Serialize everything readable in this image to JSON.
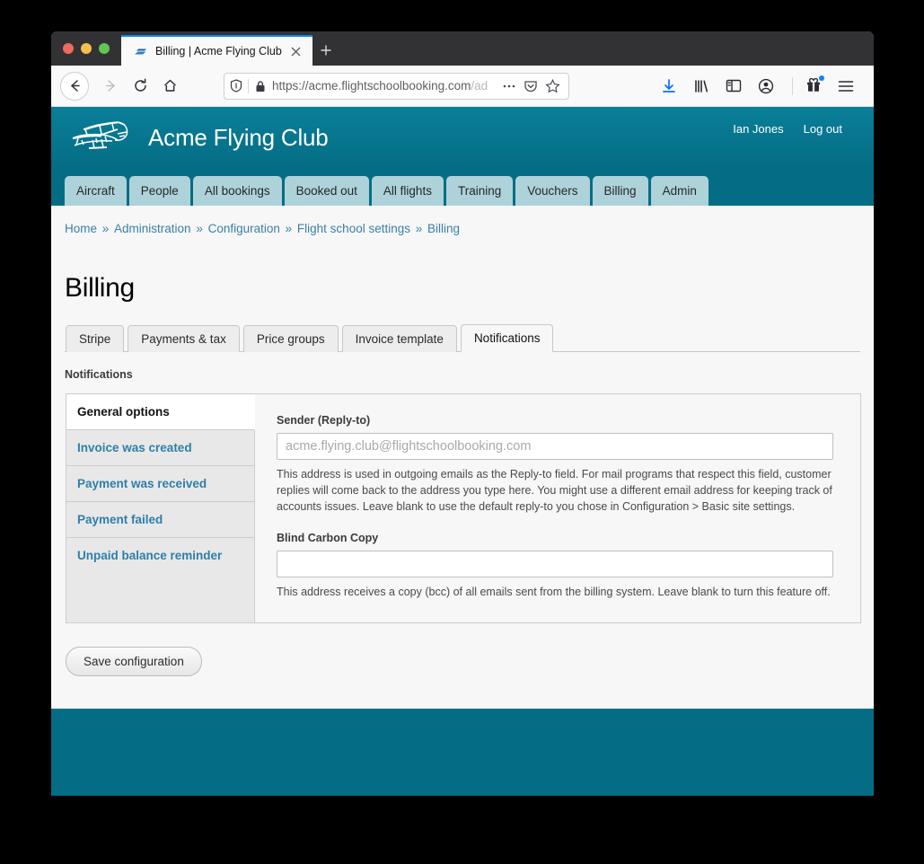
{
  "browser": {
    "tab": {
      "title": "Billing | Acme Flying Club",
      "favicon_icon": "plane-swoosh-favicon",
      "close_icon": "close-icon"
    },
    "new_tab_label": "+",
    "new_tab_icon": "plus-icon",
    "nav": {
      "back_icon": "arrow-left-icon",
      "forward_icon": "arrow-right-icon",
      "reload_icon": "reload-icon",
      "home_icon": "home-icon"
    },
    "urlbar": {
      "shield_icon": "shield-icon",
      "lock_icon": "lock-icon",
      "url_visible": "https://acme.flightschoolbooking.com",
      "url_faded": "/ad",
      "page_actions_icon": "ellipsis-icon",
      "pocket_icon": "pocket-icon",
      "bookmark_icon": "star-icon"
    },
    "toolbar": {
      "downloads_icon": "download-icon",
      "library_icon": "library-icon",
      "sidebar_icon": "sidebar-icon",
      "account_icon": "account-icon",
      "gift_icon": "gift-icon",
      "menu_icon": "hamburger-menu-icon",
      "downloads_accent": "#0a6cff",
      "gift_badge_accent": "#0a84ff"
    }
  },
  "site": {
    "title": "Acme Flying Club",
    "logo_icon": "biplane-logo-icon",
    "header_accent": "#046d85",
    "user": {
      "name": "Ian Jones",
      "logout_label": "Log out"
    },
    "nav_tabs": [
      {
        "label": "Aircraft"
      },
      {
        "label": "People"
      },
      {
        "label": "All bookings"
      },
      {
        "label": "Booked out"
      },
      {
        "label": "All flights"
      },
      {
        "label": "Training"
      },
      {
        "label": "Vouchers"
      },
      {
        "label": "Billing"
      },
      {
        "label": "Admin"
      }
    ],
    "nav_tab_color": "#aed2d9"
  },
  "breadcrumb": {
    "separator": "»",
    "items": [
      {
        "label": "Home"
      },
      {
        "label": "Administration"
      },
      {
        "label": "Configuration"
      },
      {
        "label": "Flight school settings"
      },
      {
        "label": "Billing"
      }
    ],
    "link_color": "#3a80a8"
  },
  "page": {
    "title": "Billing",
    "subtabs": [
      {
        "label": "Stripe",
        "active": false
      },
      {
        "label": "Payments & tax",
        "active": false
      },
      {
        "label": "Price groups",
        "active": false
      },
      {
        "label": "Invoice template",
        "active": false
      },
      {
        "label": "Notifications",
        "active": true
      }
    ],
    "section_label": "Notifications"
  },
  "vertical_tabs": {
    "items": [
      {
        "label": "General options",
        "active": true
      },
      {
        "label": "Invoice was created",
        "active": false
      },
      {
        "label": "Payment was received",
        "active": false
      },
      {
        "label": "Payment failed",
        "active": false
      },
      {
        "label": "Unpaid balance reminder",
        "active": false
      }
    ],
    "link_color": "#2e7fa8"
  },
  "form": {
    "sender": {
      "label": "Sender (Reply-to)",
      "value": "",
      "placeholder": "acme.flying.club@flightschoolbooking.com",
      "help": "This address is used in outgoing emails as the Reply-to field. For mail programs that respect this field, customer replies will come back to the address you type here. You might use a different email address for keeping track of accounts issues. Leave blank to use the default reply-to you chose in Configuration > Basic site settings."
    },
    "bcc": {
      "label": "Blind Carbon Copy",
      "value": "",
      "placeholder": "",
      "help": "This address receives a copy (bcc) of all emails sent from the billing system. Leave blank to turn this feature off."
    },
    "save_label": "Save configuration"
  }
}
